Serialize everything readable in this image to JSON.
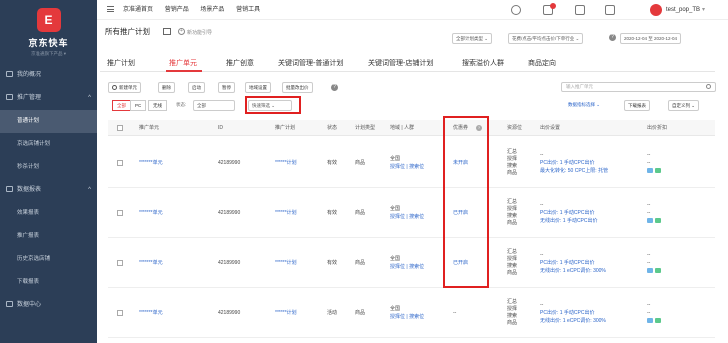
{
  "sidebar": {
    "brand": "京东快车",
    "brand_sub": "京准通旗下产品 ▾",
    "logo_letter": "E",
    "items": [
      {
        "label": "我的概况",
        "icon": "home-icon",
        "level": "top",
        "caret": ""
      },
      {
        "label": "推广管理",
        "icon": "promo-icon",
        "level": "top",
        "caret": "^"
      },
      {
        "label": "普通计划",
        "icon": "",
        "level": "sub",
        "active": true
      },
      {
        "label": "京选店铺计划",
        "icon": "",
        "level": "sub"
      },
      {
        "label": "秒杀计划",
        "icon": "",
        "level": "sub"
      },
      {
        "label": "数据报表",
        "icon": "report-icon",
        "level": "top",
        "caret": "^"
      },
      {
        "label": "效果报表",
        "icon": "",
        "level": "sub"
      },
      {
        "label": "推广报表",
        "icon": "",
        "level": "sub"
      },
      {
        "label": "历史京选店铺",
        "icon": "",
        "level": "sub"
      },
      {
        "label": "下载报表",
        "icon": "",
        "level": "sub"
      },
      {
        "label": "数据中心",
        "icon": "data-center-icon",
        "level": "top",
        "caret": ""
      }
    ]
  },
  "topbar": {
    "nav": [
      "京准通首页",
      "营销产品",
      "场景产品",
      "营销工具"
    ],
    "username": "test_pop_TB",
    "user_caret": "▾"
  },
  "header": {
    "title": "所有推广计划",
    "new_guide": "新功能引导",
    "plus": "+",
    "selects": [
      "全部计划类型 ⌄",
      "花费/点击/平均点击价/下单行业 ⌄",
      "2020-12-04 至 2020-12-04"
    ],
    "help": "?"
  },
  "tabs": [
    "推广计划",
    "推广单元",
    "推广创意",
    "关键词管理-普通计划",
    "关键词管理-店铺计划",
    "搜索溢价人群",
    "商品定向"
  ],
  "toolbar": {
    "buttons": [
      "新建单元",
      "删除",
      "启动",
      "暂停",
      "地域设置",
      "批量改出价"
    ],
    "search_placeholder": "输入推广单元",
    "help": "?"
  },
  "filters": {
    "toggles": [
      "全部",
      "PC",
      "无线"
    ],
    "status_label": "状态:",
    "status_value": "全部",
    "quick_filter": "快速筛选 ⌄",
    "metric_select": "数据指标选择 ⌄",
    "download": "下载报表",
    "custom_columns": "自定义列 ⌄"
  },
  "table": {
    "headers": [
      "推广单元",
      "ID",
      "推广计划",
      "状态",
      "计划类型",
      "地域 | 人群",
      "优惠券",
      "资源位",
      "出价设置",
      "出价折扣"
    ],
    "coupon_help": "?",
    "rows": [
      {
        "unit": "*******单元",
        "id": "42189990",
        "plan": "******计划",
        "status": "有效",
        "type": "商品",
        "region": [
          "全国",
          "授择位 | 搜索位"
        ],
        "coupon": "未开启",
        "slots": [
          "汇总",
          "授择",
          "搜索",
          "商品"
        ],
        "bid": [
          "--",
          "PC出价: 1  手动CPC出价",
          "最大化转化: 50  CPC上限: 托管"
        ],
        "discount": [
          "--",
          "--"
        ]
      },
      {
        "unit": "*******单元",
        "id": "42189990",
        "plan": "******计划",
        "status": "有效",
        "type": "商品",
        "region": [
          "全国",
          "授择位 | 搜索位"
        ],
        "coupon": "已开启",
        "slots": [
          "汇总",
          "授择",
          "搜索",
          "商品"
        ],
        "bid": [
          "--",
          "PC出价: 1  手动CPC出价",
          "无线出价: 1  手动CPC出价"
        ],
        "discount": [
          "--",
          "--"
        ]
      },
      {
        "unit": "*******单元",
        "id": "42189990",
        "plan": "******计划",
        "status": "有效",
        "type": "商品",
        "region": [
          "全国",
          "授择位 | 搜索位"
        ],
        "coupon": "已开启",
        "slots": [
          "汇总",
          "授择",
          "搜索",
          "商品"
        ],
        "bid": [
          "--",
          "PC出价: 1  手动CPC出价",
          "无线出价: 1  eCPC调价: 300%"
        ],
        "discount": [
          "--",
          "--"
        ]
      },
      {
        "unit": "*******单元",
        "id": "42189990",
        "plan": "******计划",
        "status": "活动",
        "type": "商品",
        "region": [
          "全国",
          "授择位 | 搜索位"
        ],
        "coupon": "--",
        "slots": [
          "汇总",
          "授择",
          "搜索",
          "商品"
        ],
        "bid": [
          "--",
          "PC出价: 1  手动CPC出价",
          "无线出价: 1  eCPC调价: 300%"
        ],
        "discount": [
          "--",
          "--"
        ]
      }
    ]
  },
  "colors": {
    "accent": "#e4393c",
    "link": "#2a64c9",
    "highlight": "#e02020",
    "chip_blue": "#6fb4e8",
    "chip_green": "#5cc98c"
  }
}
